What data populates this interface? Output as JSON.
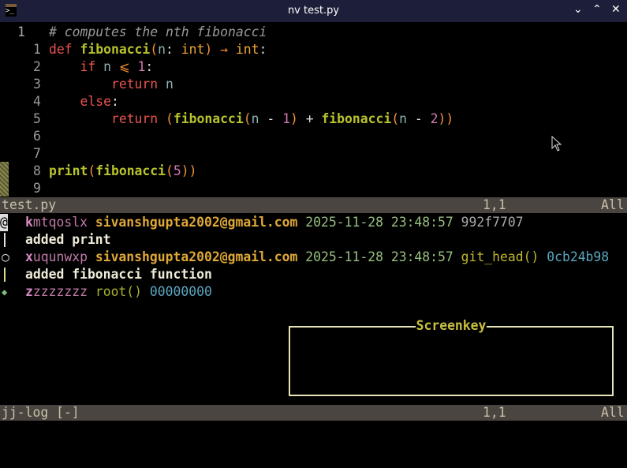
{
  "window": {
    "title": "nv test.py",
    "icon": "terminal-icon",
    "controls": [
      "minimize-icon",
      "maximize-icon",
      "close-icon"
    ]
  },
  "editor": {
    "lines": [
      {
        "num": "1",
        "current": true,
        "tokens": [
          [
            "cm",
            "# computes the nth fibonacci"
          ]
        ]
      },
      {
        "num": "1",
        "tokens": [
          [
            "kw",
            "def "
          ],
          [
            "fn",
            "fibonacci"
          ],
          [
            "pu",
            "("
          ],
          [
            "var",
            "n"
          ],
          [
            "pl",
            ": "
          ],
          [
            "ty",
            "int"
          ],
          [
            "pu",
            ")"
          ],
          [
            "op",
            " → "
          ],
          [
            "ty",
            "int"
          ],
          [
            "pl",
            ":"
          ]
        ]
      },
      {
        "num": "2",
        "tokens": [
          [
            "pl",
            "    "
          ],
          [
            "kw",
            "if "
          ],
          [
            "var",
            "n"
          ],
          [
            "op",
            " ⩽ "
          ],
          [
            "num",
            "1"
          ],
          [
            "pl",
            ":"
          ]
        ]
      },
      {
        "num": "3",
        "tokens": [
          [
            "pl",
            "        "
          ],
          [
            "kw",
            "return "
          ],
          [
            "var",
            "n"
          ]
        ]
      },
      {
        "num": "4",
        "tokens": [
          [
            "pl",
            "    "
          ],
          [
            "kw",
            "else"
          ],
          [
            "pl",
            ":"
          ]
        ]
      },
      {
        "num": "5",
        "tokens": [
          [
            "pl",
            "        "
          ],
          [
            "kw",
            "return "
          ],
          [
            "pu",
            "("
          ],
          [
            "fn",
            "fibonacci"
          ],
          [
            "pu",
            "("
          ],
          [
            "var",
            "n"
          ],
          [
            "pl",
            " - "
          ],
          [
            "num",
            "1"
          ],
          [
            "pu",
            ")"
          ],
          [
            "pl",
            " + "
          ],
          [
            "fn",
            "fibonacci"
          ],
          [
            "pu",
            "("
          ],
          [
            "var",
            "n"
          ],
          [
            "pl",
            " - "
          ],
          [
            "num",
            "2"
          ],
          [
            "pu",
            "))"
          ]
        ]
      },
      {
        "num": "6",
        "tokens": []
      },
      {
        "num": "7",
        "tokens": []
      },
      {
        "num": "8",
        "tokens": [
          [
            "fn",
            "print"
          ],
          [
            "pu",
            "("
          ],
          [
            "fn",
            "fibonacci"
          ],
          [
            "pu",
            "("
          ],
          [
            "num",
            "5"
          ],
          [
            "pu",
            "))"
          ]
        ]
      },
      {
        "num": "9",
        "tokens": []
      }
    ],
    "status": {
      "file": "test.py",
      "position": "1,1",
      "scroll": "All"
    }
  },
  "log": {
    "entries": [
      {
        "graph": "@",
        "change_id_prefix": "k",
        "change_id": "mtqoslx",
        "email": "sivanshgupta2002@gmail.com",
        "date": "2025-11-28 23:48:57",
        "bookmark": "",
        "commit": "992f7707",
        "description": "added print"
      },
      {
        "graph": "○",
        "change_id_prefix": "x",
        "change_id": "uqunwxp",
        "email": "sivanshgupta2002@gmail.com",
        "date": "2025-11-28 23:48:57",
        "bookmark": "git_head()",
        "commit": "0cb24b98",
        "description": "added fibonacci function"
      },
      {
        "graph": "◆",
        "change_id_prefix": "z",
        "change_id": "zzzzzzz",
        "email": "",
        "date": "",
        "bookmark": "root()",
        "commit": "00000000",
        "description": ""
      }
    ],
    "status": {
      "buffer": "jj-log [-]",
      "position": "1,1",
      "scroll": "All"
    }
  },
  "screenkey": {
    "title": "Screenkey"
  },
  "colors": {
    "keyword": "#e8554e",
    "function": "#b8c22c",
    "type": "#f0a830",
    "email": "#e0a838",
    "date": "#98c080",
    "status_bg": "#4a4540"
  }
}
